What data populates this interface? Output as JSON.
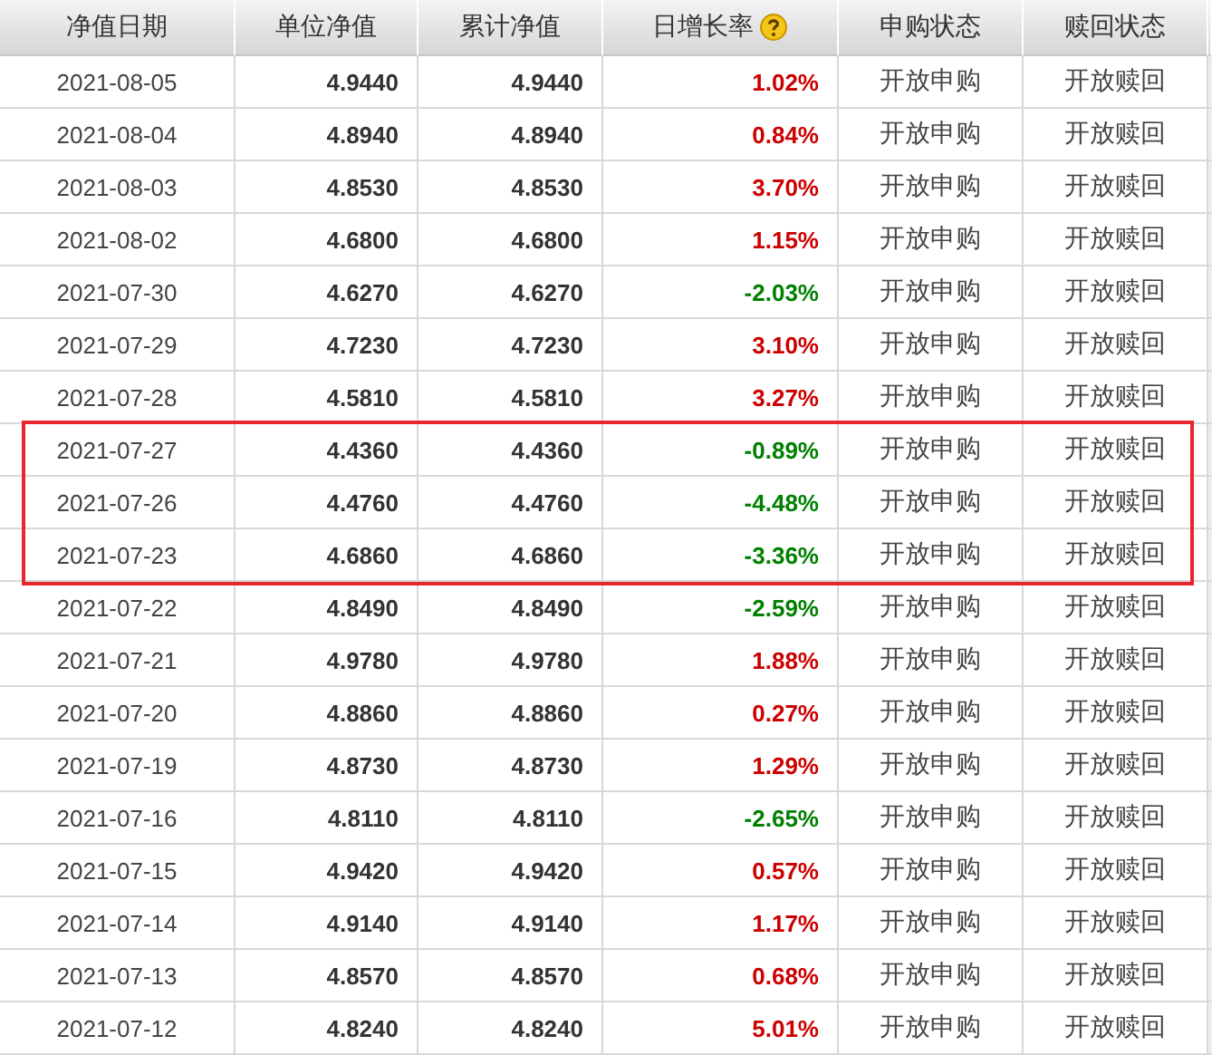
{
  "columns": [
    {
      "label": "净值日期"
    },
    {
      "label": "单位净值"
    },
    {
      "label": "累计净值"
    },
    {
      "label": "日增长率",
      "help": true
    },
    {
      "label": "申购状态"
    },
    {
      "label": "赎回状态"
    }
  ],
  "rows": [
    {
      "date": "2021-08-05",
      "nav": "4.9440",
      "acc": "4.9440",
      "change": "1.02%",
      "color": "#cc0000",
      "buy": "开放申购",
      "redeem": "开放赎回",
      "highlighted": false
    },
    {
      "date": "2021-08-04",
      "nav": "4.8940",
      "acc": "4.8940",
      "change": "0.84%",
      "color": "#cc0000",
      "buy": "开放申购",
      "redeem": "开放赎回",
      "highlighted": false
    },
    {
      "date": "2021-08-03",
      "nav": "4.8530",
      "acc": "4.8530",
      "change": "3.70%",
      "color": "#cc0000",
      "buy": "开放申购",
      "redeem": "开放赎回",
      "highlighted": false
    },
    {
      "date": "2021-08-02",
      "nav": "4.6800",
      "acc": "4.6800",
      "change": "1.15%",
      "color": "#cc0000",
      "buy": "开放申购",
      "redeem": "开放赎回",
      "highlighted": false
    },
    {
      "date": "2021-07-30",
      "nav": "4.6270",
      "acc": "4.6270",
      "change": "-2.03%",
      "color": "#008000",
      "buy": "开放申购",
      "redeem": "开放赎回",
      "highlighted": false
    },
    {
      "date": "2021-07-29",
      "nav": "4.7230",
      "acc": "4.7230",
      "change": "3.10%",
      "color": "#cc0000",
      "buy": "开放申购",
      "redeem": "开放赎回",
      "highlighted": false
    },
    {
      "date": "2021-07-28",
      "nav": "4.5810",
      "acc": "4.5810",
      "change": "3.27%",
      "color": "#cc0000",
      "buy": "开放申购",
      "redeem": "开放赎回",
      "highlighted": false
    },
    {
      "date": "2021-07-27",
      "nav": "4.4360",
      "acc": "4.4360",
      "change": "-0.89%",
      "color": "#008000",
      "buy": "开放申购",
      "redeem": "开放赎回",
      "highlighted": true
    },
    {
      "date": "2021-07-26",
      "nav": "4.4760",
      "acc": "4.4760",
      "change": "-4.48%",
      "color": "#008000",
      "buy": "开放申购",
      "redeem": "开放赎回",
      "highlighted": true
    },
    {
      "date": "2021-07-23",
      "nav": "4.6860",
      "acc": "4.6860",
      "change": "-3.36%",
      "color": "#008000",
      "buy": "开放申购",
      "redeem": "开放赎回",
      "highlighted": true
    },
    {
      "date": "2021-07-22",
      "nav": "4.8490",
      "acc": "4.8490",
      "change": "-2.59%",
      "color": "#008000",
      "buy": "开放申购",
      "redeem": "开放赎回",
      "highlighted": false
    },
    {
      "date": "2021-07-21",
      "nav": "4.9780",
      "acc": "4.9780",
      "change": "1.88%",
      "color": "#cc0000",
      "buy": "开放申购",
      "redeem": "开放赎回",
      "highlighted": false
    },
    {
      "date": "2021-07-20",
      "nav": "4.8860",
      "acc": "4.8860",
      "change": "0.27%",
      "color": "#cc0000",
      "buy": "开放申购",
      "redeem": "开放赎回",
      "highlighted": false
    },
    {
      "date": "2021-07-19",
      "nav": "4.8730",
      "acc": "4.8730",
      "change": "1.29%",
      "color": "#cc0000",
      "buy": "开放申购",
      "redeem": "开放赎回",
      "highlighted": false
    },
    {
      "date": "2021-07-16",
      "nav": "4.8110",
      "acc": "4.8110",
      "change": "-2.65%",
      "color": "#008000",
      "buy": "开放申购",
      "redeem": "开放赎回",
      "highlighted": false
    },
    {
      "date": "2021-07-15",
      "nav": "4.9420",
      "acc": "4.9420",
      "change": "0.57%",
      "color": "#cc0000",
      "buy": "开放申购",
      "redeem": "开放赎回",
      "highlighted": false
    },
    {
      "date": "2021-07-14",
      "nav": "4.9140",
      "acc": "4.9140",
      "change": "1.17%",
      "color": "#cc0000",
      "buy": "开放申购",
      "redeem": "开放赎回",
      "highlighted": false
    },
    {
      "date": "2021-07-13",
      "nav": "4.8570",
      "acc": "4.8570",
      "change": "0.68%",
      "color": "#cc0000",
      "buy": "开放申购",
      "redeem": "开放赎回",
      "highlighted": false
    },
    {
      "date": "2021-07-12",
      "nav": "4.8240",
      "acc": "4.8240",
      "change": "5.01%",
      "color": "#cc0000",
      "buy": "开放申购",
      "redeem": "开放赎回",
      "highlighted": false
    }
  ]
}
